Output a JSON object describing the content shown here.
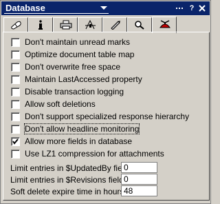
{
  "header": {
    "title": "Database",
    "controls": [
      "more-icon",
      "help-icon",
      "close-icon"
    ]
  },
  "tabs": [
    {
      "name": "info",
      "icon": "capsule-icon"
    },
    {
      "name": "info-i",
      "icon": "info-icon"
    },
    {
      "name": "print",
      "icon": "printer-icon"
    },
    {
      "name": "design",
      "icon": "design-icon"
    },
    {
      "name": "launch",
      "icon": "rocket-icon"
    },
    {
      "name": "search",
      "icon": "magnifier-icon"
    },
    {
      "name": "advanced",
      "icon": "propeller-hat-icon",
      "active": true
    }
  ],
  "options": [
    {
      "label": "Don't maintain unread marks",
      "checked": false
    },
    {
      "label": "Optimize document table map",
      "checked": false
    },
    {
      "label": "Don't overwrite free space",
      "checked": false
    },
    {
      "label": "Maintain LastAccessed property",
      "checked": false
    },
    {
      "label": "Disable transaction logging",
      "checked": false
    },
    {
      "label": "Allow soft deletions",
      "checked": false
    },
    {
      "label": "Don't support specialized response hierarchy",
      "checked": false
    },
    {
      "label": "Don't allow headline monitoring",
      "checked": false,
      "focused": true
    },
    {
      "label": "Allow more fields in database",
      "checked": true
    },
    {
      "label": "Use LZ1 compression for attachments",
      "checked": false
    }
  ],
  "fields": [
    {
      "label": "Limit entries in $UpdatedBy fields",
      "value": "0"
    },
    {
      "label": "Limit entries in $Revisions fields",
      "value": "0"
    },
    {
      "label": "Soft delete expire time in hours",
      "value": "48"
    }
  ]
}
